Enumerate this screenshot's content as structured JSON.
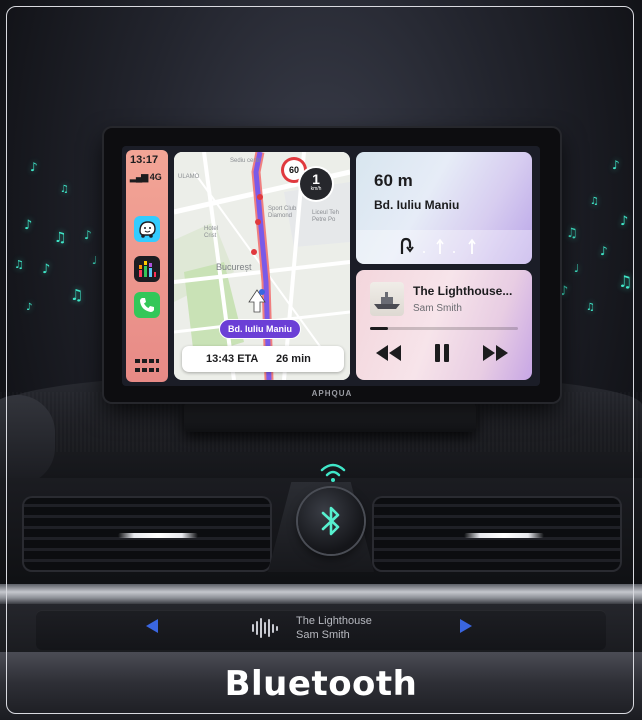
{
  "device": {
    "brand": "APHQUA",
    "status": {
      "time": "13:17",
      "signal": "4G"
    },
    "dock_apps": [
      "waze-icon",
      "music-icon",
      "phone-icon",
      "grid-icon"
    ],
    "map": {
      "labels": [
        "Hotel\nCrist",
        "Bucureșt",
        "Sport Club\nDiamond",
        "Liceul Teh\nPetre Po",
        "Sediu centr",
        "ULAMO"
      ],
      "speed_limit": "60",
      "current_speed": "1",
      "speed_unit": "km/h",
      "street": "Bd. Iuliu Maniu",
      "eta": "13:43 ETA",
      "duration": "26 min"
    },
    "navigation": {
      "distance": "60 m",
      "street": "Bd. Iuliu Maniu",
      "lane_icons": [
        "u-turn-icon",
        "straight-arrow-icon",
        "straight-arrow-icon",
        "straight-arrow-icon"
      ]
    },
    "now_playing": {
      "title": "The Lighthouse...",
      "artist": "Sam Smith",
      "progress": 0.12,
      "controls": [
        "rewind-icon",
        "pause-icon",
        "fast-forward-icon"
      ]
    }
  },
  "car_display": {
    "title": "The Lighthouse",
    "artist": "Sam Smith"
  },
  "caption": "Bluetooth",
  "colors": {
    "accent_teal": "#3fe6c8",
    "route_pill": "#6b3fd6",
    "media_arrows": "#3a66e0",
    "dock": "#e78a86"
  }
}
